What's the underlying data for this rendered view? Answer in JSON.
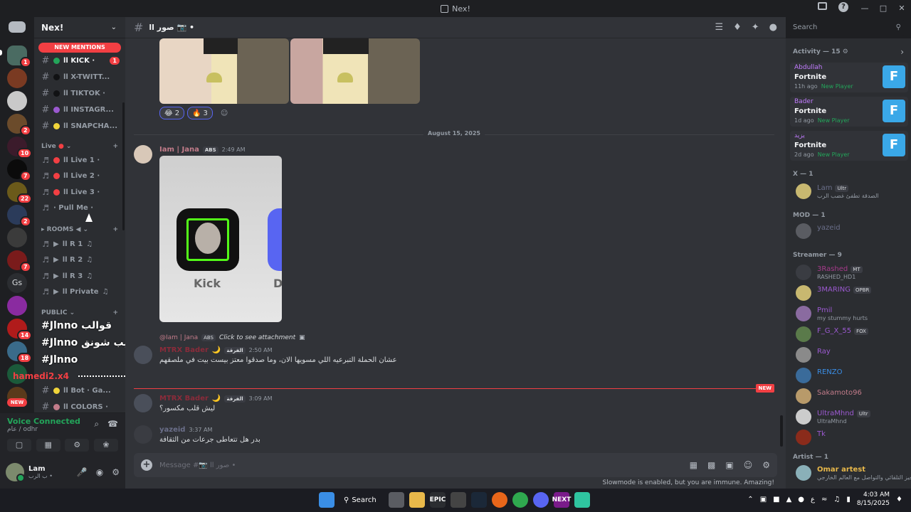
{
  "window": {
    "title": "Nex!"
  },
  "server": {
    "name": "Nex!",
    "new_mentions": "NEW MENTIONS"
  },
  "channels": {
    "social": [
      {
        "name": "ll KICK ·",
        "dot": "#23a55a",
        "count": "1",
        "bright": true
      },
      {
        "name": "ll X-TWITT...",
        "dot": "#111214"
      },
      {
        "name": "ll TIKTOK ·",
        "dot": "#111214"
      },
      {
        "name": "ll INSTAGR...",
        "dot": "#9b59d0"
      },
      {
        "name": "ll SNAPCHA...",
        "dot": "#f0d43a"
      }
    ],
    "live_category": "Live",
    "live": [
      {
        "name": "ll Live 1 ·",
        "dot": "#f23f43"
      },
      {
        "name": "ll Live 2 ·",
        "dot": "#f23f43"
      },
      {
        "name": "ll Live 3 ·",
        "dot": "#f23f43"
      },
      {
        "name": "· Pull Me ·"
      }
    ],
    "rooms_category": "ROOMS",
    "rooms": [
      {
        "name": "ll R 1"
      },
      {
        "name": "ll R 2"
      },
      {
        "name": "ll R 3"
      },
      {
        "name": "ll Private"
      }
    ],
    "public_category": "PUBLIC",
    "public_bottom": [
      {
        "name": "ll Bot · Ga..."
      },
      {
        "name": "ll COLORS ·"
      }
    ],
    "overlay_lines": [
      "#Jlnno قوالب",
      "#Jlnno تسيب شونق",
      "#Jlnno",
      "hamedi2.x4"
    ],
    "new_pill": "NEW"
  },
  "voice": {
    "status": "Voice Connected",
    "sub": "عام / odhr"
  },
  "user": {
    "name": "Lam",
    "status": "ب الرب •"
  },
  "channel_header": {
    "name": "ll صور 📷 •"
  },
  "search": {
    "placeholder": "Search"
  },
  "messages": {
    "reactions": [
      {
        "emoji": "😂",
        "count": "2"
      },
      {
        "emoji": "🔥",
        "count": "3"
      }
    ],
    "date_divider": "August 15, 2025",
    "msg1": {
      "author": "Iam | Jana",
      "tag": "ABS",
      "time": "2:49 AM",
      "image_caption": "Kick",
      "image_caption2": "D"
    },
    "reply": {
      "author": "@Iam | Jana",
      "tag": "ABS",
      "text": "Click to see attachment"
    },
    "msg2": {
      "author": "MTRX Bader",
      "tag": "الفرقة",
      "time": "2:50 AM",
      "text": "عشان الحملة التبرعيه اللي مسويها الان، وما صدقوا معتز بيست بيت في ملصقهم"
    },
    "new_label": "NEW",
    "msg3": {
      "author": "MTRX Bader",
      "tag": "الفرقة",
      "time": "3:09 AM",
      "text": "ليش قلب مكسور؟"
    },
    "msg4": {
      "author": "yazeid",
      "time": "3:37 AM",
      "text": "بدر هل تتعاطى جرعات من الثقافة"
    }
  },
  "composer": {
    "placeholder": "Message #📷 ll صور •"
  },
  "slowmode": "Slowmode is enabled, but you are immune. Amazing!",
  "members": {
    "activity_header": "Activity — 15",
    "activities": [
      {
        "name": "Abdullah",
        "game": "Fortnite",
        "time": "11h ago",
        "status": "New Player"
      },
      {
        "name": "Bader",
        "game": "Fortnite",
        "time": "1d ago",
        "status": "New Player"
      },
      {
        "name": "يزيد",
        "game": "Fortnite",
        "time": "2d ago",
        "status": "New Player"
      }
    ],
    "x_header": "X — 1",
    "x_member": {
      "name": "Lam",
      "tag": "Ultr",
      "status": "الصدقة تطفئ غضب الرب"
    },
    "mod_header": "MOD — 1",
    "mod_member": {
      "name": "yazeid"
    },
    "streamer_header": "Streamer — 9",
    "streamers": [
      {
        "name": "3Rashed",
        "tag": "MT",
        "status": "RASHED_HD1"
      },
      {
        "name": "3MARING",
        "tag": "OPBR",
        "status": ""
      },
      {
        "name": "Pmil",
        "tag": "",
        "status": "my stummy hurts"
      },
      {
        "name": "F_G_X_55",
        "tag": "FOX",
        "status": ""
      },
      {
        "name": "Ray",
        "tag": "",
        "status": ""
      },
      {
        "name": "RENZO",
        "tag": "",
        "status": ""
      },
      {
        "name": "Sakamoto96",
        "tag": "",
        "status": ""
      },
      {
        "name": "UltraMhnd",
        "tag": "Ultr",
        "status": "UltraMhnd"
      },
      {
        "name": "Tk",
        "tag": "",
        "status": ""
      }
    ],
    "artist_header": "Artist — 1",
    "artist": {
      "name": "Omar artest",
      "status": "التحيز التلقائي والتواصل مع العالم الخارجي"
    }
  },
  "taskbar": {
    "search": "Search",
    "time": "4:03 AM",
    "date": "8/15/2025",
    "lang": "ع"
  }
}
